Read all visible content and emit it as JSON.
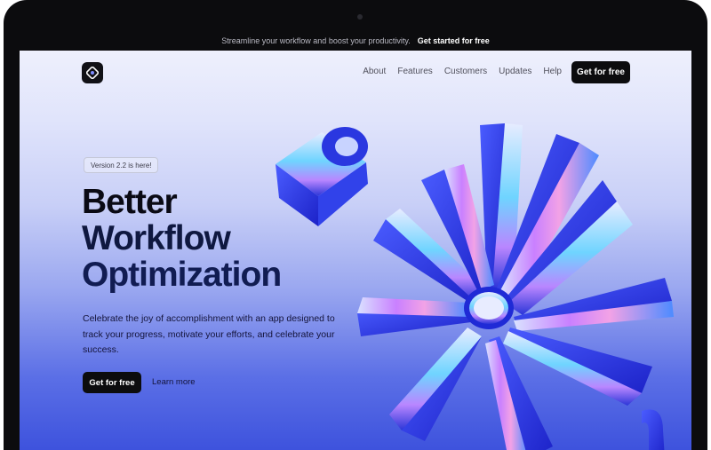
{
  "announcement": {
    "text": "Streamline your workflow and boost your productivity.",
    "cta": "Get started for free"
  },
  "header": {
    "logo_icon": "app-logo-icon",
    "nav": [
      "About",
      "Features",
      "Customers",
      "Updates",
      "Help"
    ],
    "cta": "Get for free"
  },
  "hero": {
    "badge": "Version 2.2 is here!",
    "title_lines": [
      "Better",
      "Workflow",
      "Optimization"
    ],
    "description": "Celebrate the joy of accomplishment with an app designed to track your progress, motivate your efforts, and celebrate your success.",
    "primary_button": "Get for free",
    "secondary_link": "Learn more"
  },
  "colors": {
    "accent": "#2f3fe0",
    "dark": "#0c0c0e"
  }
}
